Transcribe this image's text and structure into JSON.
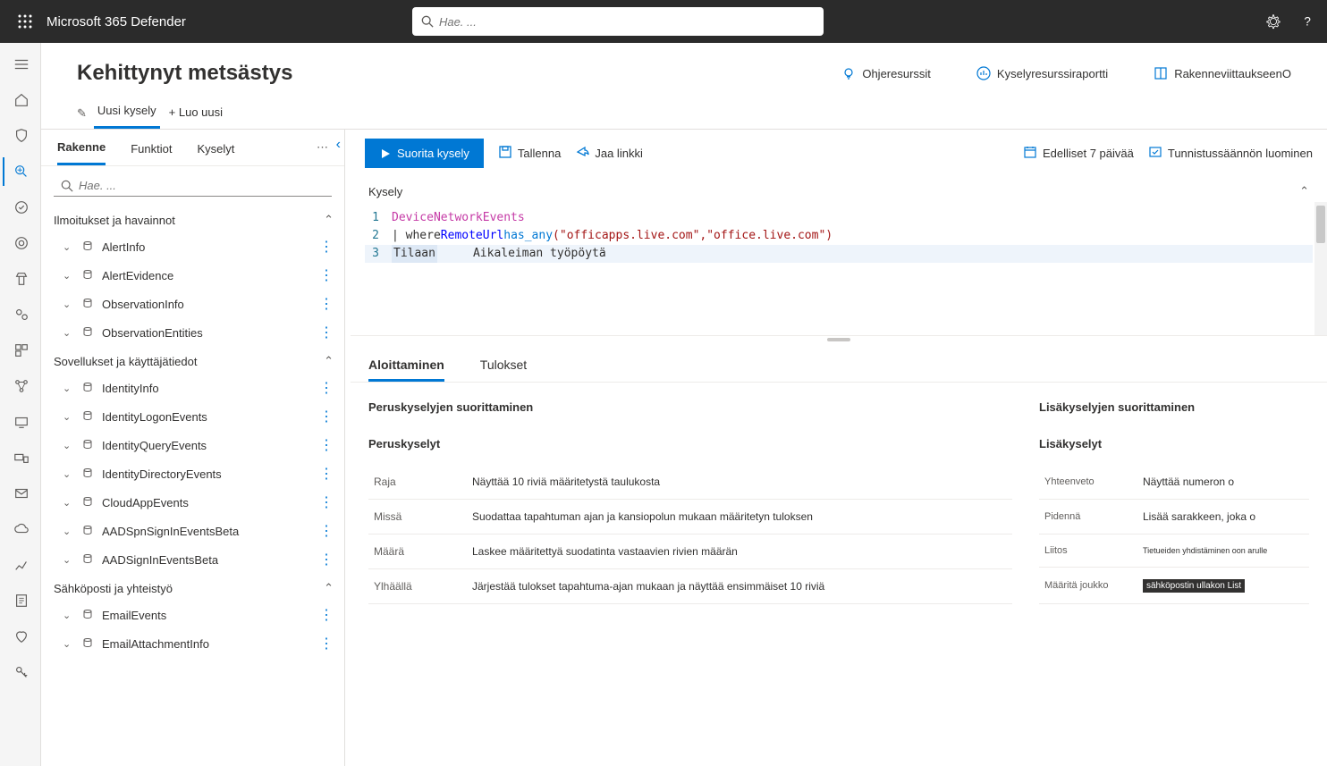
{
  "topbar": {
    "app_title": "Microsoft 365 Defender",
    "search_placeholder": "Hae. ..."
  },
  "page": {
    "title": "Kehittynyt metsästys",
    "header_links": {
      "help_resources": "Ohjeresurssit",
      "query_report": "Kyselyresurssiraportti",
      "schema_ref": "RakenneviittaukseenO"
    },
    "tabs": {
      "new_query": "Uusi kysely",
      "create_new": "+ Luo uusi"
    }
  },
  "side": {
    "tabs": {
      "schema": "Rakenne",
      "functions": "Funktiot",
      "queries": "Kyselyt"
    },
    "search_placeholder": "Hae. ...",
    "groups": [
      {
        "title": "Ilmoitukset ja havainnot",
        "tables": [
          "AlertInfo",
          "AlertEvidence",
          "ObservationInfo",
          "ObservationEntities"
        ]
      },
      {
        "title": "Sovellukset ja käyttäjätiedot",
        "tables": [
          "IdentityInfo",
          "IdentityLogonEvents",
          "IdentityQueryEvents",
          "IdentityDirectoryEvents",
          "CloudAppEvents",
          "AADSpnSignInEventsBeta",
          "AADSignInEventsBeta"
        ]
      },
      {
        "title": "Sähköposti ja yhteistyö",
        "tables": [
          "EmailEvents",
          "EmailAttachmentInfo"
        ]
      }
    ]
  },
  "toolbar": {
    "run": "Suorita kysely",
    "save": "Tallenna",
    "share": "Jaa linkki",
    "timerange": "Edelliset 7 päivää",
    "create_rule": "Tunnistussäännön luominen"
  },
  "editor": {
    "label": "Kysely",
    "line1_table": "DeviceNetworkEvents",
    "line2_pipe": "| where ",
    "line2_col": "RemoteUrl",
    "line2_fn": " has_any ",
    "line2_args": "(\"officapps.live.com\",\"office.live.com\")",
    "line3_a": "Tilaan",
    "line3_b": "Aikaleiman työpöytä"
  },
  "results": {
    "tabs": {
      "getting_started": "Aloittaminen",
      "results": "Tulokset"
    }
  },
  "starter": {
    "left_title": "Peruskyselyjen suorittaminen",
    "left_subtitle": "Peruskyselyt",
    "left_rows": [
      {
        "k": "Raja",
        "v": "Näyttää 10 riviä määritetystä taulukosta"
      },
      {
        "k": "Missä",
        "v": "Suodattaa tapahtuman ajan ja kansiopolun mukaan määritetyn tuloksen"
      },
      {
        "k": "Määrä",
        "v": "Laskee määritettyä suodatinta vastaavien rivien määrän"
      },
      {
        "k": "Ylhäällä",
        "v": "Järjestää tulokset tapahtuma-ajan mukaan ja näyttää ensimmäiset 10 riviä"
      }
    ],
    "right_title": "Lisäkyselyjen suorittaminen",
    "right_subtitle": "Lisäkyselyt",
    "right_rows": [
      {
        "k": "Yhteenveto",
        "v": "Näyttää numeron o"
      },
      {
        "k": "Pidennä",
        "v": "Lisää sarakkeen, joka o"
      },
      {
        "k": "Liitos",
        "v": "Tietueiden yhdistäminen oon arulle"
      },
      {
        "k": "Määritä joukko",
        "v": "sähköpostin ullakon List"
      }
    ]
  }
}
